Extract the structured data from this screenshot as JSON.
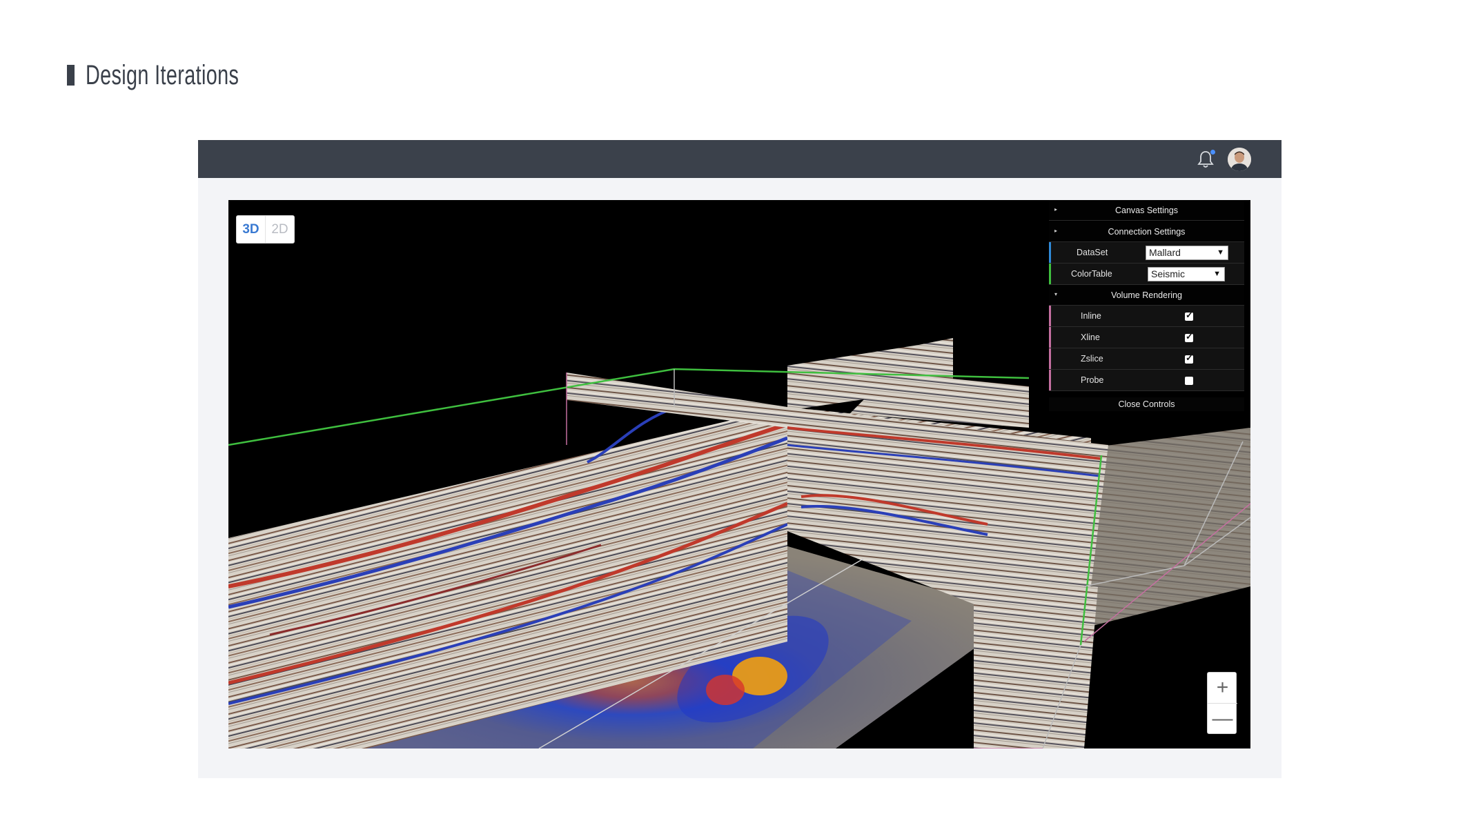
{
  "page": {
    "heading": "Design Iterations"
  },
  "topbar": {
    "bell_icon": "bell-icon",
    "avatar": "user-avatar"
  },
  "viewer": {
    "view_modes": [
      {
        "label": "3D",
        "active": true
      },
      {
        "label": "2D",
        "active": false
      }
    ],
    "controls": {
      "canvas_settings": "Canvas Settings",
      "connection_settings": "Connection Settings",
      "dataset_label": "DataSet",
      "dataset_value": "Mallard",
      "colortable_label": "ColorTable",
      "colortable_value": "Seismic",
      "volume_rendering": "Volume Rendering",
      "layers": [
        {
          "label": "Inline",
          "checked": true
        },
        {
          "label": "Xline",
          "checked": true
        },
        {
          "label": "Zslice",
          "checked": true
        },
        {
          "label": "Probe",
          "checked": false
        }
      ],
      "close_controls": "Close Controls"
    },
    "zoom": {
      "in_label": "+",
      "out_label": "—"
    }
  },
  "colors": {
    "topbar": "#3b414b",
    "accent_blue": "#3a7ad2",
    "inline_edge": "#3fbf3f",
    "xline_edge": "#c46fa0",
    "seismic_red": "#c0392b",
    "seismic_blue": "#2a3fb8"
  }
}
